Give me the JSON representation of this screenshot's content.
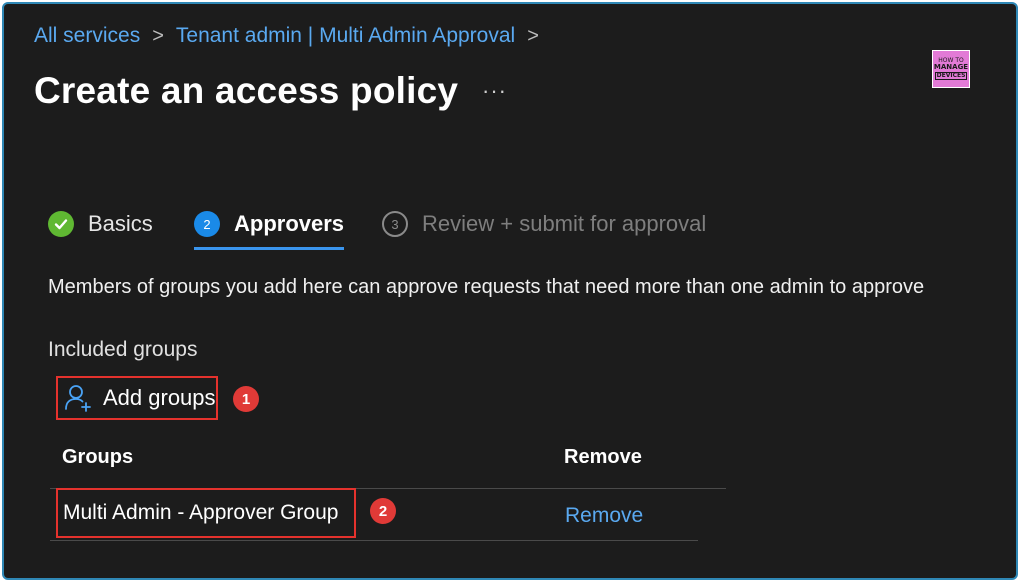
{
  "breadcrumb": {
    "items": [
      "All services",
      "Tenant admin | Multi Admin Approval"
    ],
    "separator": ">"
  },
  "page": {
    "title": "Create an access policy",
    "more_label": "···"
  },
  "logo": {
    "line1": "HOW TO",
    "line2": "MANAGE",
    "line3": "DEVICES"
  },
  "tabs": [
    {
      "number": "✓",
      "label": "Basics",
      "state": "completed"
    },
    {
      "number": "2",
      "label": "Approvers",
      "state": "active"
    },
    {
      "number": "3",
      "label": "Review + submit for approval",
      "state": "disabled"
    }
  ],
  "description": "Members of groups you add here can approve requests that need more than one admin to approve",
  "included_groups": {
    "heading": "Included groups",
    "add_button": "Add groups",
    "add_icon": "add-user-icon"
  },
  "table": {
    "columns": [
      "Groups",
      "Remove"
    ],
    "rows": [
      {
        "group": "Multi Admin - Approver Group",
        "action": "Remove"
      }
    ]
  },
  "callouts": [
    "1",
    "2"
  ],
  "colors": {
    "background": "#1c1c1c",
    "link": "#5aa9f0",
    "accent": "#1a8ae8",
    "success": "#5fb832",
    "highlight": "#e5322d",
    "frame": "#2f88b6"
  }
}
